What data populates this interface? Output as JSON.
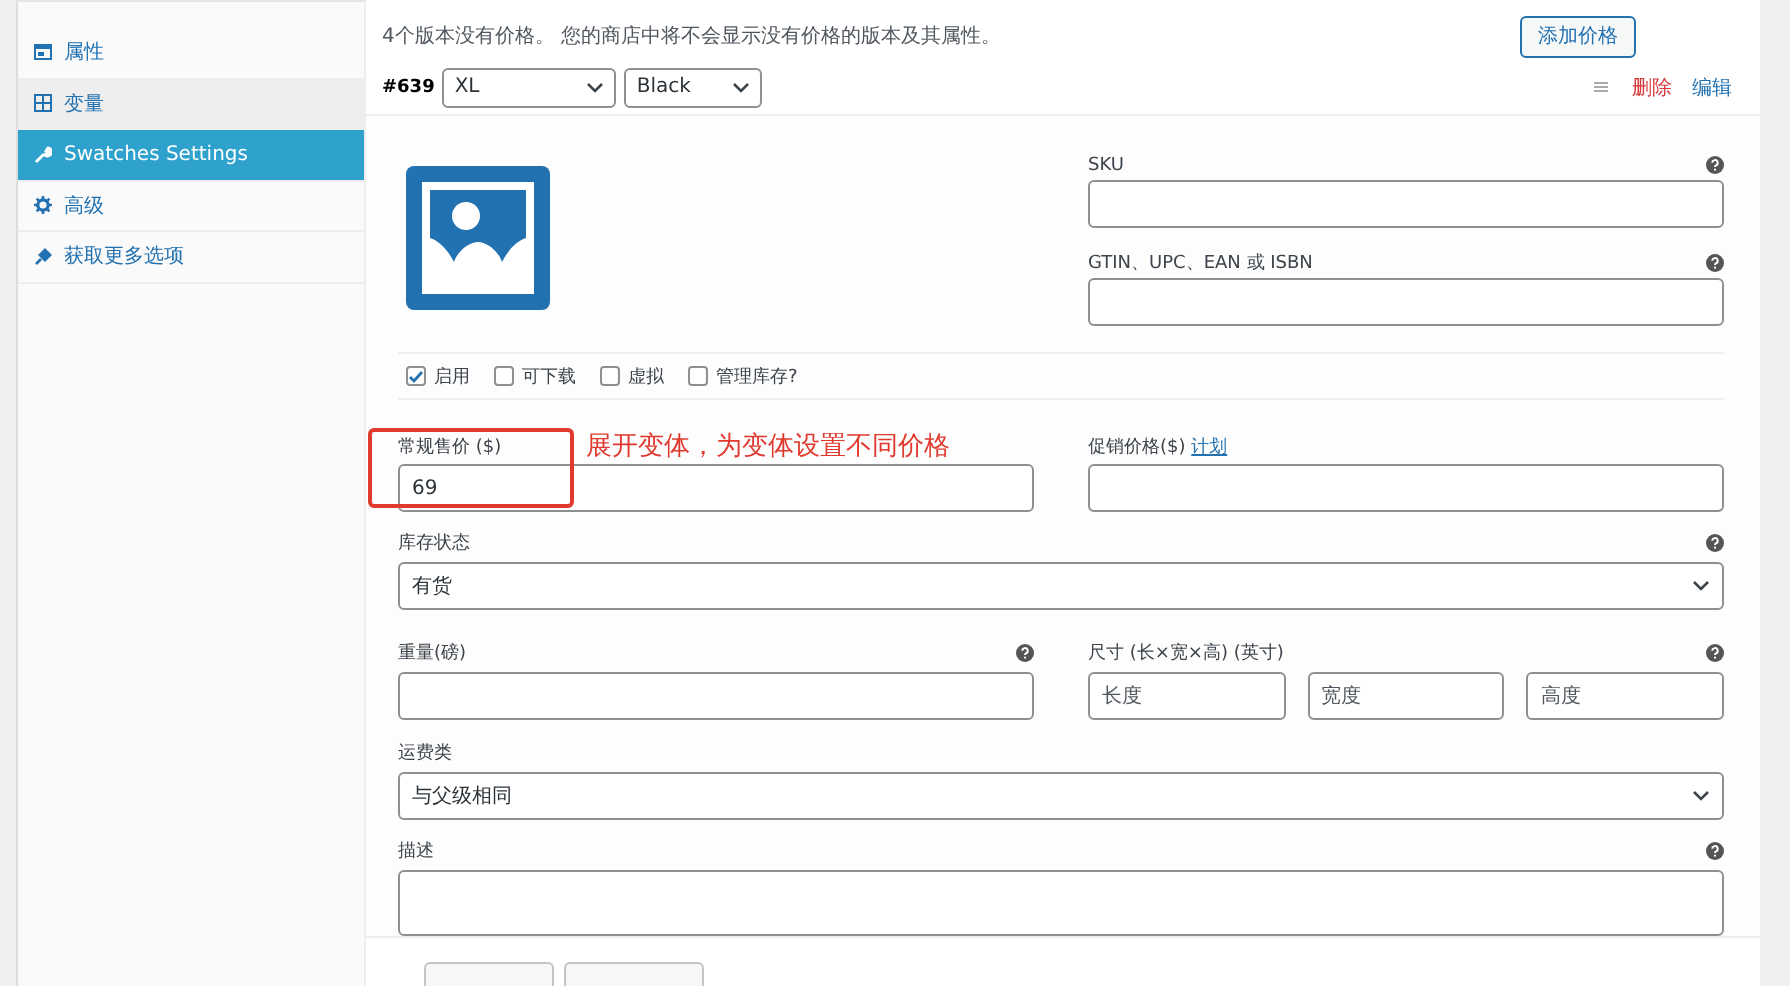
{
  "sidebar": {
    "items": [
      {
        "label": "属性",
        "kind": "attributes",
        "selected": false,
        "active": false
      },
      {
        "label": "变量",
        "kind": "variations",
        "selected": false,
        "active": true
      },
      {
        "label": "Swatches Settings",
        "kind": "swatches",
        "selected": true,
        "active": false
      },
      {
        "label": "高级",
        "kind": "advanced",
        "selected": false,
        "active": false
      },
      {
        "label": "获取更多选项",
        "kind": "more",
        "selected": false,
        "active": false
      }
    ]
  },
  "notice": "4个版本没有价格。 您的商店中将不会显示没有价格的版本及其属性。",
  "add_price_button": "添加价格",
  "variation": {
    "id": "#639",
    "selects": [
      "XL",
      "Black"
    ],
    "delete": "删除",
    "edit": "编辑"
  },
  "sku": {
    "label": "SKU"
  },
  "gtin": {
    "label": "GTIN、UPC、EAN 或 ISBN"
  },
  "checkboxes": [
    {
      "label": "启用",
      "checked": true
    },
    {
      "label": "可下载",
      "checked": false
    },
    {
      "label": "虚拟",
      "checked": false
    },
    {
      "label": "管理库存?",
      "checked": false
    }
  ],
  "regular_price": {
    "label": "常规售价 ($)",
    "value": "69"
  },
  "sale_price": {
    "label": "促销价格($)",
    "link": "计划"
  },
  "annotation": "展开变体，为变体设置不同价格",
  "stock_status": {
    "label": "库存状态",
    "value": "有货"
  },
  "weight": {
    "label": "重量(磅)"
  },
  "dimensions": {
    "label": "尺寸 (长×宽×高) (英寸)",
    "placeholders": [
      "长度",
      "宽度",
      "高度"
    ]
  },
  "shipping_class": {
    "label": "运费类",
    "value": "与父级相同"
  },
  "description": {
    "label": "描述"
  }
}
